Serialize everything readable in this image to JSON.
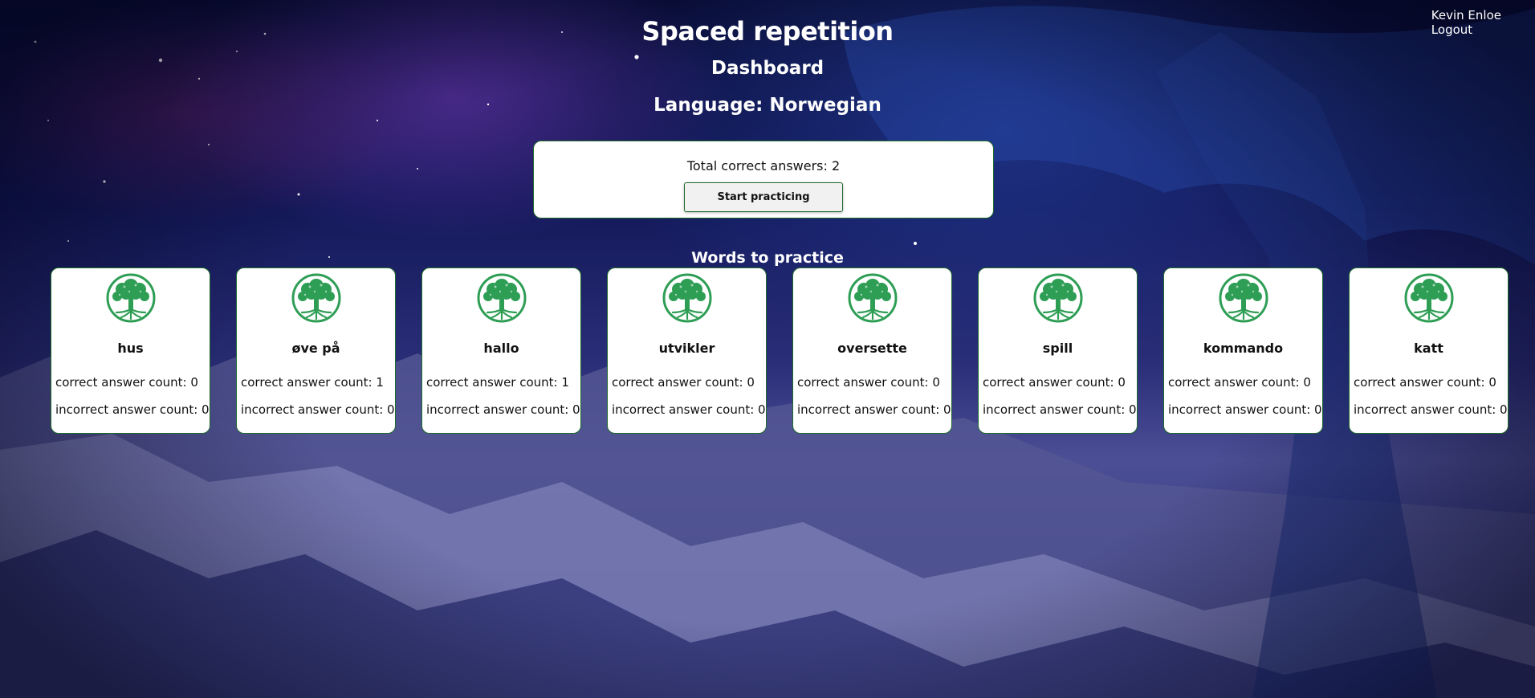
{
  "app": {
    "title": "Spaced repetition"
  },
  "user_nav": {
    "user_name": "Kevin Enloe",
    "logout_label": "Logout"
  },
  "dashboard": {
    "page_title": "Dashboard",
    "language_heading": "Language: Norwegian",
    "total_correct": "Total correct answers: 2",
    "start_button_label": "Start practicing",
    "words_heading": "Words to practice"
  },
  "words": [
    {
      "word": "hus",
      "correct": "correct answer count: 0",
      "incorrect": "incorrect answer count: 0"
    },
    {
      "word": "øve på",
      "correct": "correct answer count: 1",
      "incorrect": "incorrect answer count: 0"
    },
    {
      "word": "hallo",
      "correct": "correct answer count: 1",
      "incorrect": "incorrect answer count: 0"
    },
    {
      "word": "utvikler",
      "correct": "correct answer count: 0",
      "incorrect": "incorrect answer count: 0"
    },
    {
      "word": "oversette",
      "correct": "correct answer count: 0",
      "incorrect": "incorrect answer count: 0"
    },
    {
      "word": "spill",
      "correct": "correct answer count: 0",
      "incorrect": "incorrect answer count: 0"
    },
    {
      "word": "kommando",
      "correct": "correct answer count: 0",
      "incorrect": "incorrect answer count: 0"
    },
    {
      "word": "katt",
      "correct": "correct answer count: 0",
      "incorrect": "incorrect answer count: 0"
    }
  ],
  "icons": {
    "card_icon": "tree-of-life-icon"
  },
  "colors": {
    "accent": "#1f6b2c",
    "tree_green": "#2e9e55",
    "card_background": "#ffffff",
    "button_background": "#f1f1f1"
  }
}
